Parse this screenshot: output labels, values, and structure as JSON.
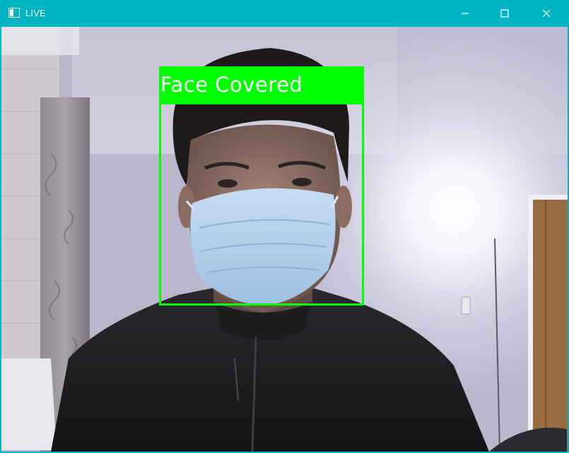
{
  "window": {
    "title": "LIVE",
    "titlebar_color": "#00b4c4",
    "controls": {
      "minimize_icon": "minimize-icon",
      "maximize_icon": "maximize-icon",
      "close_icon": "close-icon"
    }
  },
  "detection": {
    "label": "Face Covered",
    "box_color": "#00ff00",
    "label_text_color": "#ffffff"
  }
}
